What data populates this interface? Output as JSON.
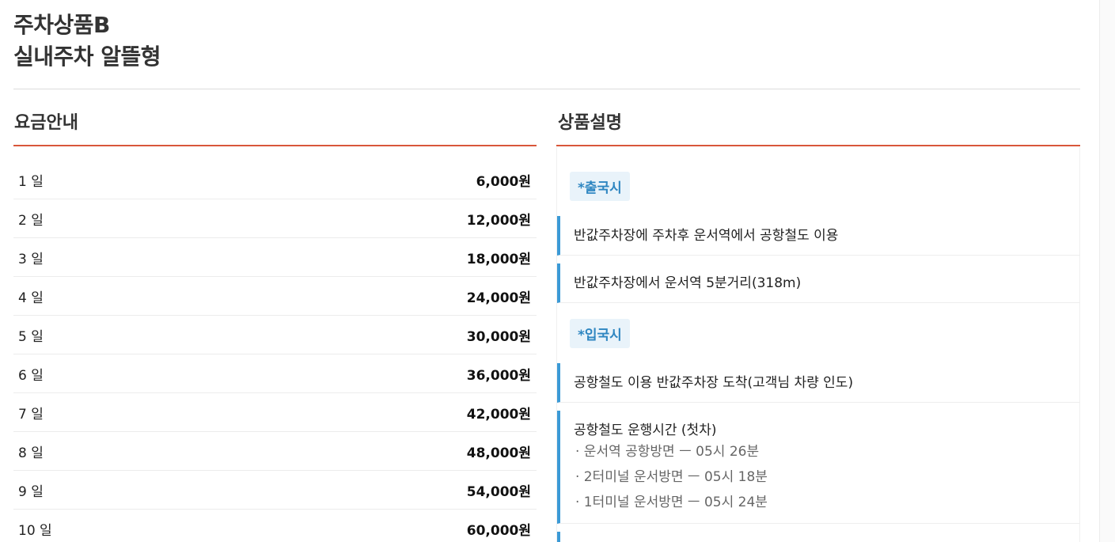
{
  "title": {
    "line1": "주차상품B",
    "line2": "실내주차 알뜰형"
  },
  "pricing": {
    "heading": "요금안내",
    "rows": [
      {
        "day": "1 일",
        "price": "6,000원"
      },
      {
        "day": "2 일",
        "price": "12,000원"
      },
      {
        "day": "3 일",
        "price": "18,000원"
      },
      {
        "day": "4 일",
        "price": "24,000원"
      },
      {
        "day": "5 일",
        "price": "30,000원"
      },
      {
        "day": "6 일",
        "price": "36,000원"
      },
      {
        "day": "7 일",
        "price": "42,000원"
      },
      {
        "day": "8 일",
        "price": "48,000원"
      },
      {
        "day": "9 일",
        "price": "54,000원"
      },
      {
        "day": "10 일",
        "price": "60,000원"
      }
    ]
  },
  "description": {
    "heading": "상품설명",
    "departure_tag": "*출국시",
    "departure_items": [
      "반값주차장에 주차후 운서역에서 공항철도 이용",
      "반값주차장에서 운서역 5분거리(318m)"
    ],
    "arrival_tag": "*입국시",
    "arrival_item": "공항철도 이용 반값주차장 도착(고객님 차량 인도)",
    "schedule": {
      "title": "공항철도 운행시간 (첫차)",
      "lines": [
        "· 운서역 공항방면 ㅡ 05시 26분",
        "· 2터미널 운서방면 ㅡ 05시 18분",
        "· 1터미널 운서방면 ㅡ 05시 24분"
      ]
    }
  },
  "colors": {
    "accent_red": "#d9573a",
    "accent_blue": "#3b9ad6",
    "tag_bg": "#e9f3fa",
    "tag_text": "#2e86c1"
  }
}
